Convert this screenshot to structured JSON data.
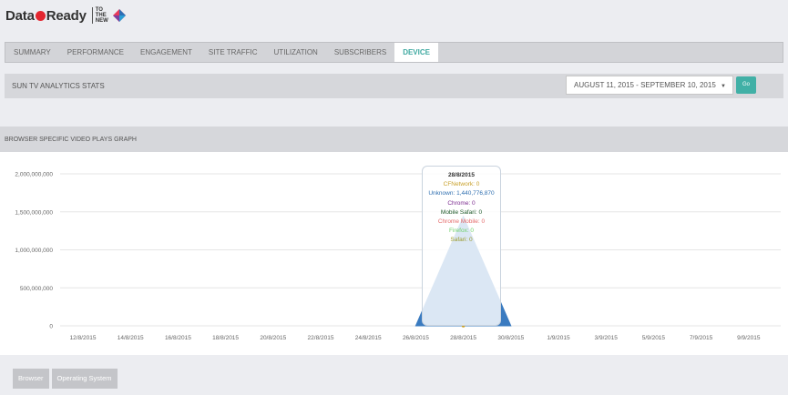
{
  "header": {
    "logo_left": "Data",
    "logo_right": "Ready",
    "logo_ttn": [
      "TO",
      "THE",
      "NEW"
    ]
  },
  "tabs": [
    {
      "label": "SUMMARY",
      "active": false
    },
    {
      "label": "PERFORMANCE",
      "active": false
    },
    {
      "label": "ENGAGEMENT",
      "active": false
    },
    {
      "label": "SITE TRAFFIC",
      "active": false
    },
    {
      "label": "UTILIZATION",
      "active": false
    },
    {
      "label": "SUBSCRIBERS",
      "active": false
    },
    {
      "label": "DEVICE",
      "active": true
    }
  ],
  "stats": {
    "title": "SUN TV ANALYTICS STATS",
    "date_range": "AUGUST 11, 2015 - SEPTEMBER 10, 2015",
    "go_label": "Go"
  },
  "graph": {
    "title": "BROWSER SPECIFIC VIDEO PLAYS GRAPH"
  },
  "tooltip": {
    "date": "28/8/2015",
    "rows": [
      {
        "text": "CFNetwork: 0",
        "color": "#c8a02a"
      },
      {
        "text": "Unknown: 1,440,776,870",
        "color": "#2f6fb0"
      },
      {
        "text": "Chrome: 0",
        "color": "#7b2b8f"
      },
      {
        "text": "Mobile Safari: 0",
        "color": "#1f5a2a"
      },
      {
        "text": "Chrome Mobile: 0",
        "color": "#e46a6a"
      },
      {
        "text": "Firefox: 0",
        "color": "#6fd06a"
      },
      {
        "text": "Safari: 0",
        "color": "#9a9a2a"
      }
    ]
  },
  "chart_data": {
    "type": "area",
    "x": [
      "12/8/2015",
      "14/8/2015",
      "16/8/2015",
      "18/8/2015",
      "20/8/2015",
      "22/8/2015",
      "24/8/2015",
      "26/8/2015",
      "28/8/2015",
      "30/8/2015",
      "1/9/2015",
      "3/9/2015",
      "5/9/2015",
      "7/9/2015",
      "9/9/2015"
    ],
    "y_ticks": [
      "0",
      "500,000,000",
      "1,000,000,000",
      "1,500,000,000",
      "2,000,000,000"
    ],
    "ylim": [
      0,
      2000000000
    ],
    "series": [
      {
        "name": "Unknown",
        "color": "#3a7bc0",
        "points": [
          [
            "26/8/2015",
            0
          ],
          [
            "28/8/2015",
            1440776870
          ],
          [
            "30/8/2015",
            0
          ]
        ]
      }
    ],
    "grid": true
  },
  "footer": {
    "buttons": [
      "Browser",
      "Operating System"
    ]
  }
}
